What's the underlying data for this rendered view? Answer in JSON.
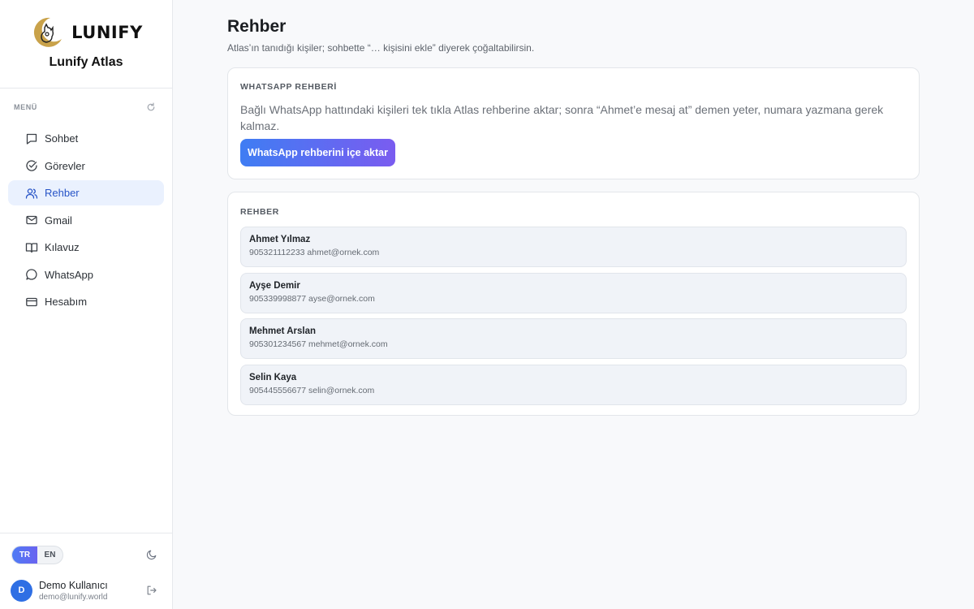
{
  "brand": {
    "logo_word": "LUNIFY",
    "name": "Lunify Atlas"
  },
  "menu": {
    "title": "MENÜ",
    "items": [
      {
        "label": "Sohbet",
        "icon": "chat-icon"
      },
      {
        "label": "Görevler",
        "icon": "check-circle-icon"
      },
      {
        "label": "Rehber",
        "icon": "users-icon",
        "active": true
      },
      {
        "label": "Gmail",
        "icon": "mail-icon"
      },
      {
        "label": "Kılavuz",
        "icon": "book-icon"
      },
      {
        "label": "WhatsApp",
        "icon": "whatsapp-bubble-icon"
      },
      {
        "label": "Hesabım",
        "icon": "card-icon"
      }
    ]
  },
  "language": {
    "tr": "TR",
    "en": "EN",
    "selected": "TR"
  },
  "user": {
    "initial": "D",
    "name": "Demo Kullanıcı",
    "email": "demo@lunify.world"
  },
  "page": {
    "title": "Rehber",
    "subtitle": "Atlas’ın tanıdığı kişiler; sohbette “… kişisini ekle” diyerek çoğaltabilirsin."
  },
  "whatsapp_card": {
    "title": "WHATSAPP REHBERİ",
    "description": "Bağlı WhatsApp hattındaki kişileri tek tıkla Atlas rehberine aktar; sonra “Ahmet’e mesaj at” demen yeter, numara yazmana gerek kalmaz.",
    "button_label": "WhatsApp rehberini içe aktar"
  },
  "contacts_card": {
    "title": "REHBER",
    "contacts": [
      {
        "name": "Ahmet Yılmaz",
        "meta": "905321112233 ahmet@ornek.com"
      },
      {
        "name": "Ayşe Demir",
        "meta": "905339998877 ayse@ornek.com"
      },
      {
        "name": "Mehmet Arslan",
        "meta": "905301234567 mehmet@ornek.com"
      },
      {
        "name": "Selin Kaya",
        "meta": "905445556677 selin@ornek.com"
      }
    ]
  },
  "colors": {
    "accent": "#2754c7",
    "active_bg": "#eaf1fe",
    "button_start": "#3f7df3",
    "button_end": "#7a5cf0",
    "avatar": "#2f6fe4"
  }
}
